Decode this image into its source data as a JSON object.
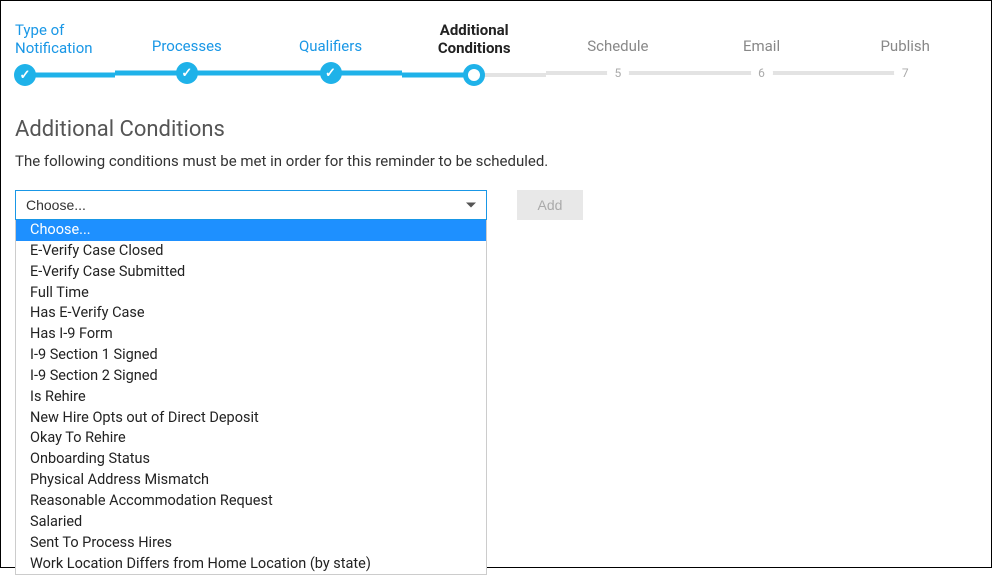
{
  "stepper": {
    "steps": [
      {
        "label": "Type of\nNotification",
        "state": "completed"
      },
      {
        "label": "Processes",
        "state": "completed"
      },
      {
        "label": "Qualifiers",
        "state": "completed"
      },
      {
        "label": "Additional\nConditions",
        "state": "current"
      },
      {
        "label": "Schedule",
        "state": "upcoming",
        "num": "5"
      },
      {
        "label": "Email",
        "state": "upcoming",
        "num": "6"
      },
      {
        "label": "Publish",
        "state": "upcoming",
        "num": "7"
      }
    ]
  },
  "page": {
    "title": "Additional Conditions",
    "description": "The following conditions must be met in order for this reminder to be scheduled."
  },
  "select": {
    "value": "Choose...",
    "options": [
      "Choose...",
      "E-Verify Case Closed",
      "E-Verify Case Submitted",
      "Full Time",
      "Has E-Verify Case",
      "Has I-9 Form",
      "I-9 Section 1 Signed",
      "I-9 Section 2 Signed",
      "Is Rehire",
      "New Hire Opts out of Direct Deposit",
      "Okay To Rehire",
      "Onboarding Status",
      "Physical Address Mismatch",
      "Reasonable Accommodation Request",
      "Salaried",
      "Sent To Process Hires",
      "Work Location Differs from Home Location (by state)"
    ],
    "selected_index": 0
  },
  "buttons": {
    "add": "Add"
  }
}
